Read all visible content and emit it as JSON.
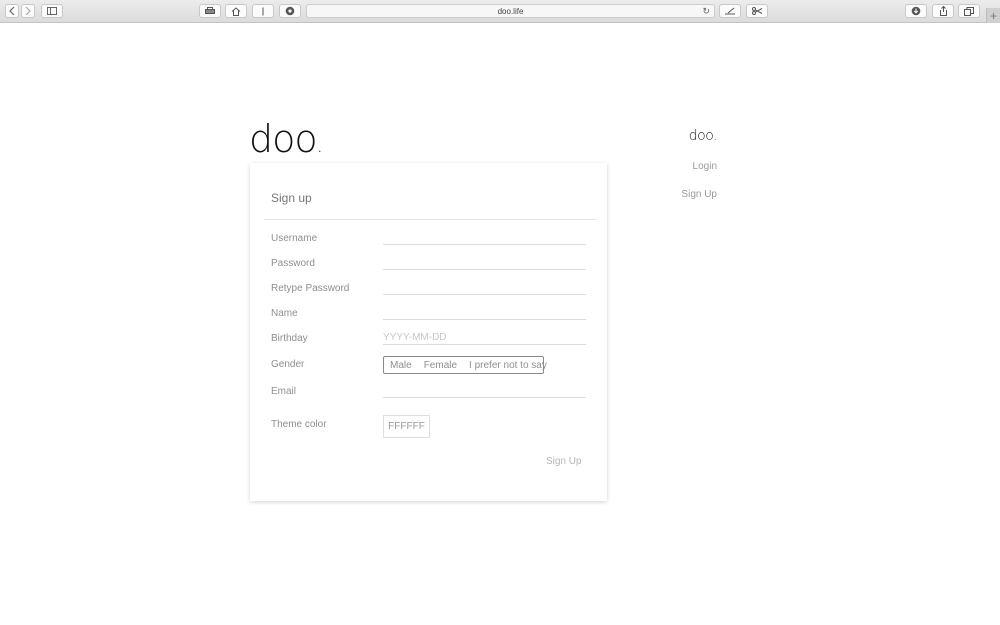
{
  "browser": {
    "url": "doo.life"
  },
  "logo": {
    "text": "doo",
    "dot": "."
  },
  "nav": {
    "logo_text": "doo.",
    "login_label": "Login",
    "signup_label": "Sign Up"
  },
  "form": {
    "title": "Sign up",
    "fields": {
      "username_label": "Username",
      "password_label": "Password",
      "retype_label": "Retype Password",
      "name_label": "Name",
      "birthday_label": "Birthday",
      "birthday_placeholder": "YYYY-MM-DD",
      "gender_label": "Gender",
      "email_label": "Email",
      "theme_label": "Theme color",
      "theme_value": "FFFFFF"
    },
    "gender_options": [
      "Male",
      "Female",
      "I prefer not to say"
    ],
    "submit_label": "Sign Up"
  }
}
